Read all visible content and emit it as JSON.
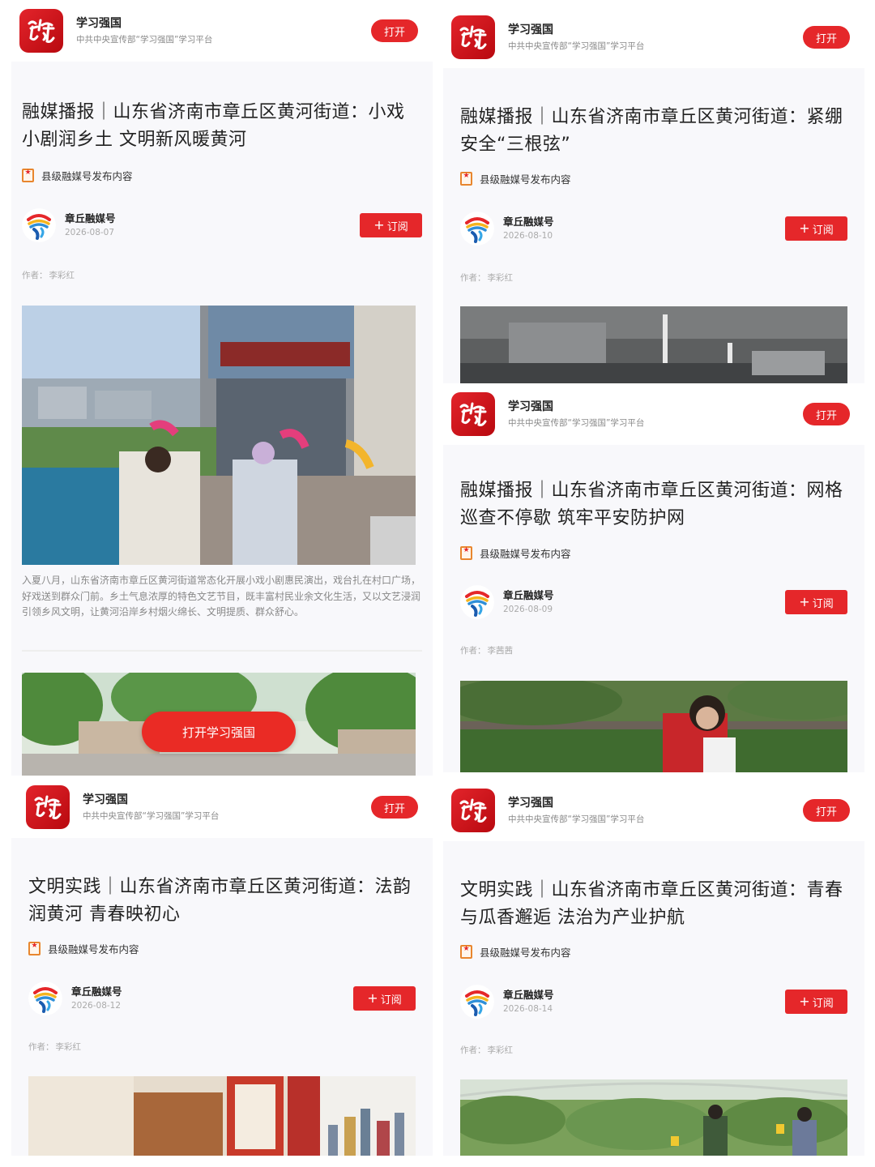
{
  "app": {
    "name": "学习强国",
    "desc": "中共中央宣传部“学习强国”学习平台",
    "open_label": "打开"
  },
  "common": {
    "badge_text": "县级融媒号发布内容",
    "author_name": "章丘融媒号",
    "subscribe_label": "订阅",
    "byline_label": "作者："
  },
  "cta": {
    "label": "打开学习强国"
  },
  "articles": [
    {
      "title": "融媒播报｜山东省济南市章丘区黄河街道：小戏小剧润乡土 文明新风暖黄河",
      "date": "2026-08-07",
      "author": "李彩红",
      "caption": "入夏八月，山东省济南市章丘区黄河街道常态化开展小戏小剧惠民演出，戏台扎在村口广场，好戏送到群众门前。乡土气息浓厚的特色文艺节目，既丰富村民业余文化生活，又以文艺浸润引领乡风文明，让黄河沿岸乡村烟火绵长、文明提质、群众舒心。"
    },
    {
      "title": "融媒播报｜山东省济南市章丘区黄河街道：紧绷安全“三根弦”",
      "date": "2026-08-10",
      "author": "李彩红"
    },
    {
      "title": "融媒播报｜山东省济南市章丘区黄河街道：网格巡查不停歇 筑牢平安防护网",
      "date": "2026-08-09",
      "author": "李茜茜"
    },
    {
      "title": "文明实践｜山东省济南市章丘区黄河街道：法韵润黄河 青春映初心",
      "date": "2026-08-12",
      "author": "李彩红"
    },
    {
      "title": "文明实践｜山东省济南市章丘区黄河街道：青春与瓜香邂逅 法治为产业护航",
      "date": "2026-08-14",
      "author": "李彩红"
    }
  ],
  "colors": {
    "brand_red": "#e5272a",
    "background": "#f8f8fb",
    "badge_orange": "#e8862e"
  }
}
